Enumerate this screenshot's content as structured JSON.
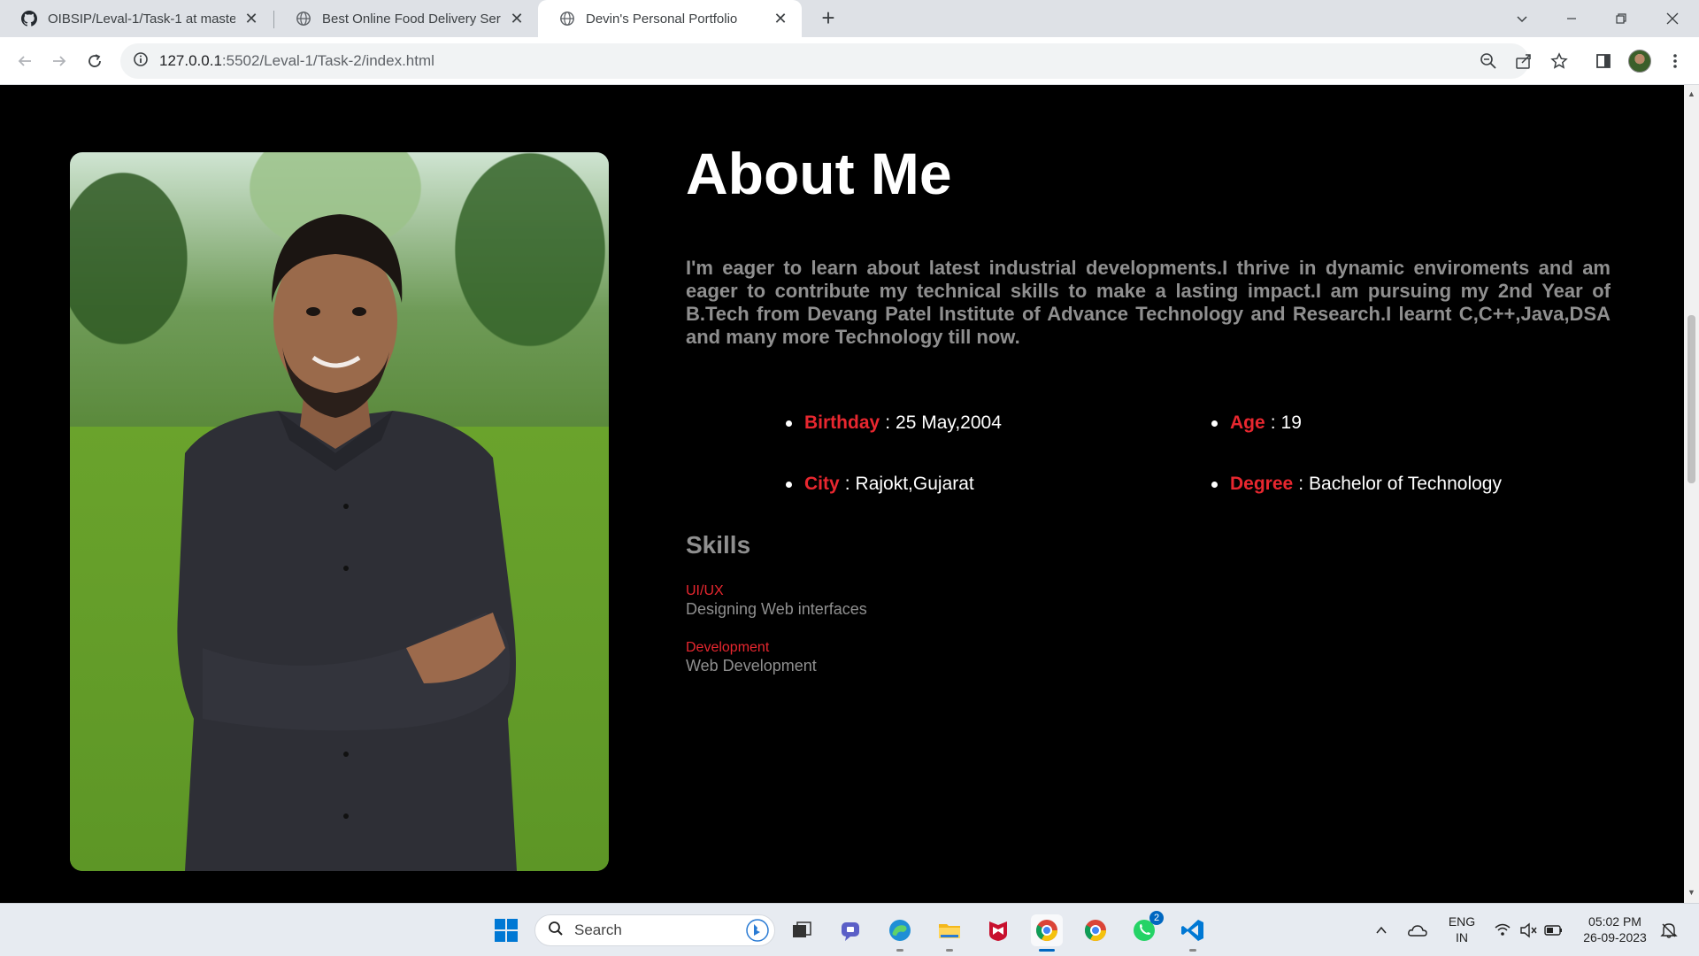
{
  "browser": {
    "tabs": [
      {
        "title": "OIBSIP/Leval-1/Task-1 at master",
        "icon": "github-icon"
      },
      {
        "title": "Best Online Food Delivery Servic",
        "icon": "globe-icon"
      },
      {
        "title": "Devin's Personal Portfolio",
        "icon": "globe-icon",
        "active": true
      }
    ],
    "url_host": "127.0.0.1",
    "url_path": ":5502/Leval-1/Task-2/index.html"
  },
  "page": {
    "about_title": "About Me",
    "about_text": "I'm eager to learn about latest industrial developments.I thrive in dynamic enviroments and am eager to contribute my technical skills to make a lasting impact.I am pursuing my 2nd Year of B.Tech from Devang Patel Institute of Advance Technology and Research.I learnt C,C++,Java,DSA and many more Technology till now.",
    "info": {
      "birthday_label": "Birthday",
      "birthday_value": "25 May,2004",
      "age_label": "Age",
      "age_value": "19",
      "city_label": "City",
      "city_value": "Rajokt,Gujarat",
      "degree_label": "Degree",
      "degree_value": "Bachelor of Technology",
      "separator": ":"
    },
    "skills_title": "Skills",
    "skills": [
      {
        "name": "UI/UX",
        "desc": "Designing Web interfaces"
      },
      {
        "name": "Development",
        "desc": "Web Development"
      }
    ],
    "accent_color": "#e8272f"
  },
  "taskbar": {
    "search_placeholder": "Search",
    "lang_line1": "ENG",
    "lang_line2": "IN",
    "time": "05:02 PM",
    "date": "26-09-2023",
    "whatsapp_badge": "2"
  }
}
